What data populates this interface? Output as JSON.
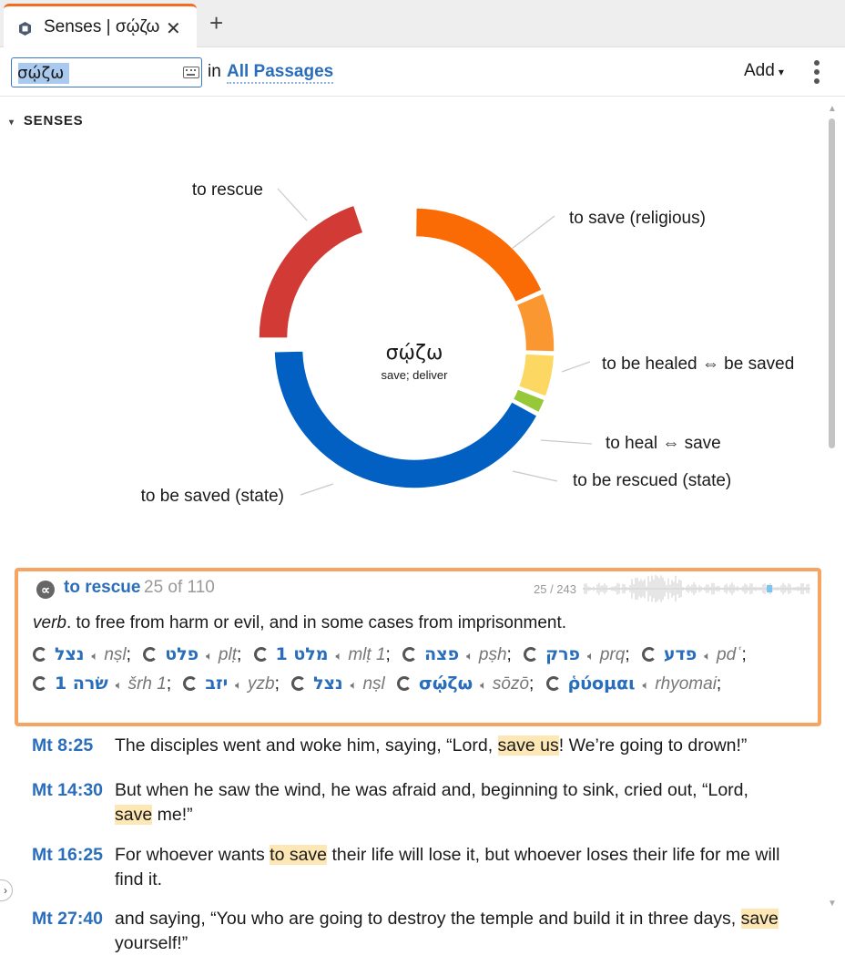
{
  "tab": {
    "title": "Senses | σῴζω",
    "close_glyph": "✕",
    "add_glyph": "+"
  },
  "toolbar": {
    "search_value": "σῴζω",
    "in_label": "in",
    "passages_label": "All Passages",
    "add_label": "Add",
    "add_caret": "▾"
  },
  "section": {
    "caret": "▾",
    "title": "SENSES"
  },
  "chart_data": {
    "type": "pie",
    "center_title": "σῴζω",
    "center_subtitle": "save; deliver",
    "slices": [
      {
        "label": "to save (religious)",
        "share": 0.184,
        "color": "#fa6a05"
      },
      {
        "label": "to be healed ⇔ be saved",
        "share": 0.072,
        "color": "#fb9731"
      },
      {
        "label": "to heal ⇔ save",
        "share": 0.052,
        "color": "#fcd762"
      },
      {
        "label": "to be rescued (state)",
        "share": 0.02,
        "color": "#96c83a"
      },
      {
        "label": "to be saved (state)",
        "share": 0.42,
        "color": "#0360c3"
      },
      {
        "label": "to rescue",
        "share": 0.202,
        "color": "#d13a35",
        "selected": true
      }
    ],
    "colors": {
      "leader": "#c9c9c9"
    }
  },
  "sense": {
    "icon_glyph": "∝",
    "name": "to rescue",
    "count": "25 of 110",
    "ratio": "25 / 243",
    "pos": "verb",
    "definition": ". to free from harm or evil, and in some cases from imprisonment.",
    "lemmas": [
      {
        "word": "נצל",
        "tr": "nṣl",
        "sep": ";"
      },
      {
        "word": "פלט",
        "tr": "plṭ",
        "sep": ";"
      },
      {
        "word": "מלט 1",
        "tr": "mlṭ 1",
        "sep": ";"
      },
      {
        "word": "פצה",
        "tr": "pṣh",
        "sep": ";"
      },
      {
        "word": "פרק",
        "tr": "prq",
        "sep": ";"
      },
      {
        "word": "פדע",
        "tr": "pdʿ",
        "sep": ";"
      },
      {
        "word": "שׂרה 1",
        "tr": "šrh 1",
        "sep": ";"
      },
      {
        "word": "יזב",
        "tr": "yzb",
        "sep": ";"
      },
      {
        "word": "נצל",
        "tr": "nṣl",
        "sep": ""
      },
      {
        "word": "σῴζω",
        "tr": "sōzō",
        "sep": ";"
      },
      {
        "word": "ῥύομαι",
        "tr": "rhyomai",
        "sep": ";"
      }
    ]
  },
  "verses": [
    {
      "ref": "Mt 8:25",
      "parts": [
        {
          "t": "The disciples went and woke him, saying, “Lord, ",
          "h": false
        },
        {
          "t": "save us",
          "h": true
        },
        {
          "t": "! We’re going to drown!”",
          "h": false
        }
      ]
    },
    {
      "ref": "Mt 14:30",
      "parts": [
        {
          "t": "But when he saw the wind, he was afraid and, beginning to sink, cried out, “Lord, ",
          "h": false
        },
        {
          "t": "save",
          "h": true
        },
        {
          "t": " me!”",
          "h": false
        }
      ]
    },
    {
      "ref": "Mt 16:25",
      "parts": [
        {
          "t": "For whoever wants ",
          "h": false
        },
        {
          "t": "to save",
          "h": true
        },
        {
          "t": " their life will lose it, but whoever loses their life for me will find it.",
          "h": false
        }
      ]
    },
    {
      "ref": "Mt 27:40",
      "parts": [
        {
          "t": "and saying, “You who are going to destroy the temple and build it in three days, ",
          "h": false
        },
        {
          "t": "save",
          "h": true
        },
        {
          "t": " yourself!”",
          "h": false
        }
      ]
    }
  ],
  "side_toggle_glyph": "›"
}
